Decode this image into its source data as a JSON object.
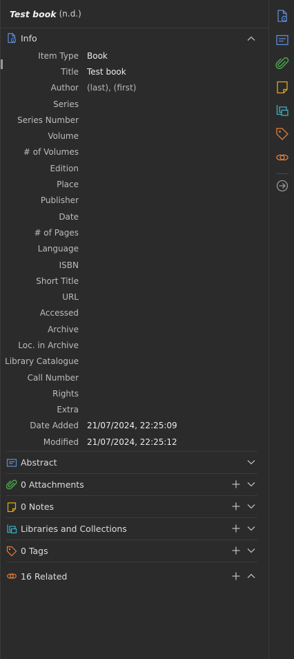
{
  "header": {
    "title": "Test book",
    "date": "(n.d.)"
  },
  "info": {
    "label": "Info",
    "fields": [
      {
        "label": "Item Type",
        "value": "Book"
      },
      {
        "label": "Title",
        "value": "Test book"
      },
      {
        "label": "Author",
        "value": "(last),  (first)"
      },
      {
        "label": "Series",
        "value": ""
      },
      {
        "label": "Series Number",
        "value": ""
      },
      {
        "label": "Volume",
        "value": ""
      },
      {
        "label": "# of Volumes",
        "value": ""
      },
      {
        "label": "Edition",
        "value": ""
      },
      {
        "label": "Place",
        "value": ""
      },
      {
        "label": "Publisher",
        "value": ""
      },
      {
        "label": "Date",
        "value": ""
      },
      {
        "label": "# of Pages",
        "value": ""
      },
      {
        "label": "Language",
        "value": ""
      },
      {
        "label": "ISBN",
        "value": ""
      },
      {
        "label": "Short Title",
        "value": ""
      },
      {
        "label": "URL",
        "value": ""
      },
      {
        "label": "Accessed",
        "value": ""
      },
      {
        "label": "Archive",
        "value": ""
      },
      {
        "label": "Loc. in Archive",
        "value": ""
      },
      {
        "label": "Library Catalogue",
        "value": ""
      },
      {
        "label": "Call Number",
        "value": ""
      },
      {
        "label": "Rights",
        "value": ""
      },
      {
        "label": "Extra",
        "value": ""
      },
      {
        "label": "Date Added",
        "value": "21/07/2024, 22:25:09"
      },
      {
        "label": "Modified",
        "value": "21/07/2024, 22:25:12"
      }
    ]
  },
  "sections": {
    "abstract": "Abstract",
    "attachments": "0 Attachments",
    "notes": "0 Notes",
    "libraries": "Libraries and Collections",
    "tags": "0 Tags",
    "related": "16 Related"
  },
  "colors": {
    "info": "#5b8dd9",
    "abstract": "#5b8dd9",
    "attachments": "#4caf50",
    "notes": "#e6a817",
    "libraries": "#3ab3c4",
    "tags": "#e67e3a",
    "related": "#e67e3a"
  },
  "rail_icons": [
    "info-icon",
    "abstract-icon",
    "attachments-icon",
    "notes-icon",
    "libraries-icon",
    "tags-icon",
    "related-icon",
    "locate-icon"
  ]
}
